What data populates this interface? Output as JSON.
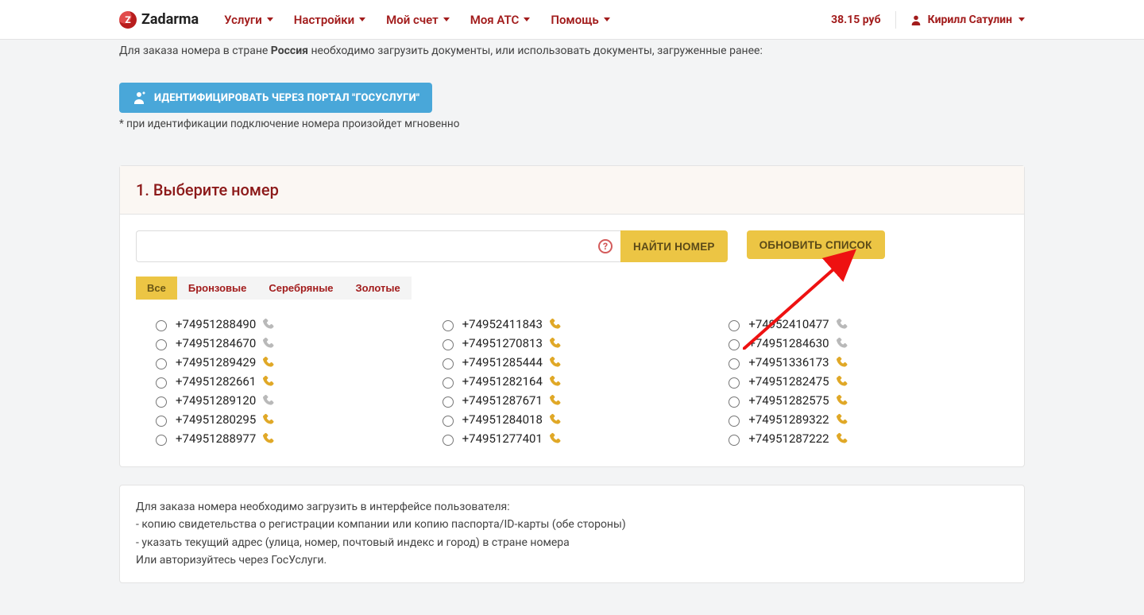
{
  "brand": "Zadarma",
  "nav": {
    "items": [
      "Услуги",
      "Настройки",
      "Мой счет",
      "Моя АТС",
      "Помощь"
    ],
    "balance": "38.15 руб",
    "user": "Кирилл Сатулин"
  },
  "intro": {
    "prefix": "Для заказа номера в стране ",
    "country": "Россия",
    "suffix": " необходимо загрузить документы, или использовать документы, загруженные ранее:"
  },
  "gos_button": "ИДЕНТИФИЦИРОВАТЬ ЧЕРЕЗ ПОРТАЛ \"ГОСУСЛУГИ\"",
  "gos_note": "* при идентификации подключение номера произойдет мгновенно",
  "panel1": {
    "title": "1. Выберите номер",
    "search_placeholder": "",
    "search_value": "",
    "search_button": "НАЙТИ НОМЕР",
    "refresh_button": "ОБНОВИТЬ СПИСОК",
    "help_char": "?",
    "filters": [
      "Все",
      "Бронзовые",
      "Серебряные",
      "Золотые"
    ],
    "active_filter": 0,
    "numbers": [
      {
        "n": "+74951288490",
        "tier": "grey"
      },
      {
        "n": "+74952411843",
        "tier": "gold"
      },
      {
        "n": "+74952410477",
        "tier": "grey"
      },
      {
        "n": "+74951284670",
        "tier": "grey"
      },
      {
        "n": "+74951270813",
        "tier": "gold"
      },
      {
        "n": "+74951284630",
        "tier": "grey"
      },
      {
        "n": "+74951289429",
        "tier": "gold"
      },
      {
        "n": "+74951285444",
        "tier": "gold"
      },
      {
        "n": "+74951336173",
        "tier": "gold"
      },
      {
        "n": "+74951282661",
        "tier": "gold"
      },
      {
        "n": "+74951282164",
        "tier": "gold"
      },
      {
        "n": "+74951282475",
        "tier": "gold"
      },
      {
        "n": "+74951289120",
        "tier": "grey"
      },
      {
        "n": "+74951287671",
        "tier": "gold"
      },
      {
        "n": "+74951282575",
        "tier": "gold"
      },
      {
        "n": "+74951280295",
        "tier": "gold"
      },
      {
        "n": "+74951284018",
        "tier": "gold"
      },
      {
        "n": "+74951289322",
        "tier": "gold"
      },
      {
        "n": "+74951288977",
        "tier": "gold"
      },
      {
        "n": "+74951277401",
        "tier": "gold"
      },
      {
        "n": "+74951287222",
        "tier": "gold"
      }
    ]
  },
  "info": {
    "line1": "Для заказа номера необходимо загрузить в интерфейсе пользователя:",
    "line2": "- копию свидетельства о регистрации компании или копию паспорта/ID-карты (обе стороны)",
    "line3": "- указать текущий адрес (улица, номер, почтовый индекс и город) в стране номера",
    "line4": "Или авторизуйтесь через ГосУслуги."
  }
}
